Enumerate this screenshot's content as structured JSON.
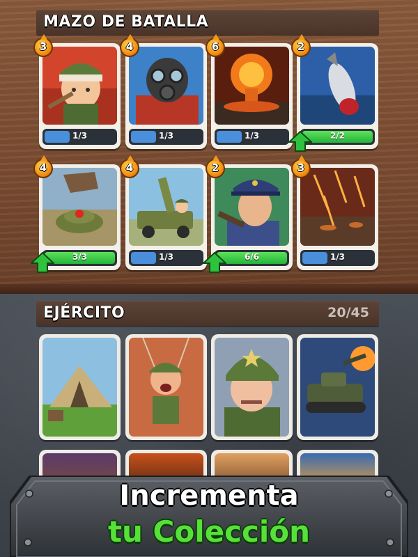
{
  "deck": {
    "title": "MAZO DE BATALLA",
    "cards": [
      {
        "name": "bandaged-soldier",
        "cost": "3",
        "progress": "1/3",
        "fill": 0.333,
        "upgradable": false
      },
      {
        "name": "gas-mask-trooper",
        "cost": "4",
        "progress": "1/3",
        "fill": 0.333,
        "upgradable": false
      },
      {
        "name": "nuclear-explosion",
        "cost": "6",
        "progress": "1/3",
        "fill": 0.333,
        "upgradable": false
      },
      {
        "name": "missile-strike",
        "cost": "2",
        "progress": "2/2",
        "fill": 1.0,
        "upgradable": true
      },
      {
        "name": "landmine",
        "cost": "4",
        "progress": "3/3",
        "fill": 1.0,
        "upgradable": true
      },
      {
        "name": "rocket-jeep",
        "cost": "4",
        "progress": "1/3",
        "fill": 0.333,
        "upgradable": false
      },
      {
        "name": "officer",
        "cost": "2",
        "progress": "6/6",
        "fill": 1.0,
        "upgradable": true
      },
      {
        "name": "artillery-barrage",
        "cost": "3",
        "progress": "1/3",
        "fill": 0.333,
        "upgradable": false
      }
    ]
  },
  "army": {
    "title": "EJÉRCITO",
    "count": "20/45",
    "cards": [
      "army-tent",
      "paratrooper",
      "general",
      "tank"
    ]
  },
  "banner": {
    "line1": "Incrementa",
    "line2": "tu Colección"
  },
  "colors": {
    "progress_blue": "#4a8fdc",
    "progress_green": "#2fc23e",
    "accent_orange": "#f39a18"
  }
}
